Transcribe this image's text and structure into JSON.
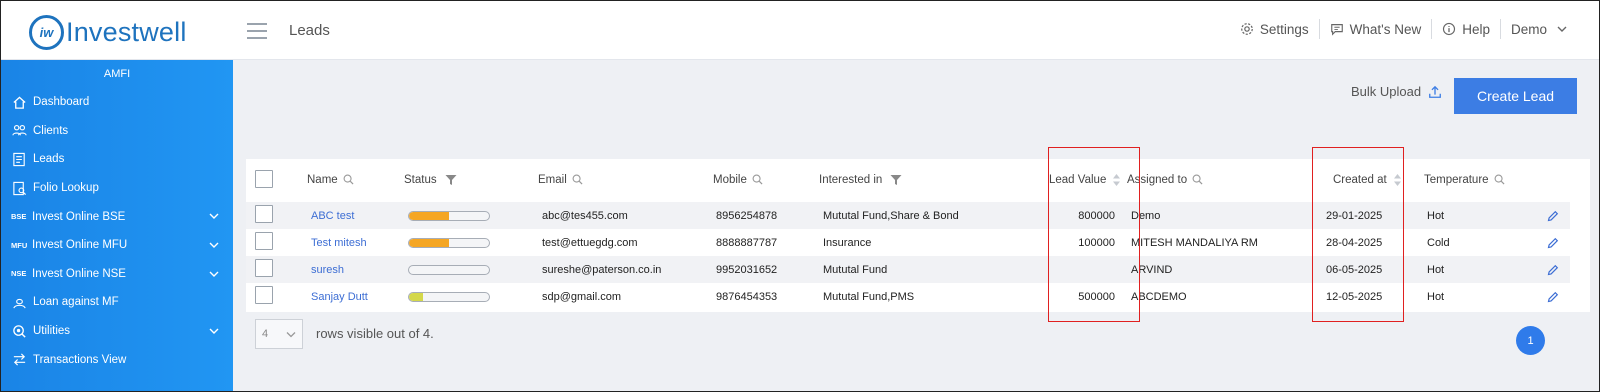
{
  "brand": {
    "logo_mark": "iw",
    "name": "Investwell"
  },
  "header": {
    "page_title": "Leads",
    "actions": [
      {
        "label": "Settings",
        "icon": "gear-icon"
      },
      {
        "label": "What's New",
        "icon": "message-icon"
      },
      {
        "label": "Help",
        "icon": "info-icon"
      },
      {
        "label": "Demo",
        "icon": "chevron-down-icon"
      }
    ]
  },
  "sidebar": {
    "org": "AMFI",
    "items": [
      {
        "label": "Dashboard",
        "icon": "home-icon"
      },
      {
        "label": "Clients",
        "icon": "users-icon"
      },
      {
        "label": "Leads",
        "icon": "leads-icon"
      },
      {
        "label": "Folio Lookup",
        "icon": "folio-icon"
      },
      {
        "label": "Invest Online BSE",
        "tag": "BSE",
        "expandable": true
      },
      {
        "label": "Invest Online MFU",
        "tag": "MFU",
        "expandable": true
      },
      {
        "label": "Invest Online NSE",
        "tag": "NSE",
        "expandable": true
      },
      {
        "label": "Loan against MF",
        "icon": "loan-icon"
      },
      {
        "label": "Utilities",
        "icon": "utilities-icon",
        "expandable": true
      },
      {
        "label": "Transactions View",
        "icon": "transfer-icon"
      }
    ]
  },
  "toolbar": {
    "bulk_upload": "Bulk Upload",
    "create_lead": "Create Lead"
  },
  "table": {
    "columns": {
      "name": "Name",
      "status": "Status",
      "email": "Email",
      "mobile": "Mobile",
      "interested": "Interested in",
      "lead_value": "Lead Value",
      "assigned": "Assigned to",
      "created": "Created at",
      "temperature": "Temperature"
    },
    "rows": [
      {
        "name": "ABC test",
        "status_progress": 0.5,
        "status_color": "#f5a623",
        "email": "abc@tes455.com",
        "mobile": "8956254878",
        "interested": "Mututal Fund,Share & Bond",
        "lead_value": "800000",
        "assigned": "Demo",
        "created": "29-01-2025",
        "temperature": "Hot"
      },
      {
        "name": "Test mitesh",
        "status_progress": 0.5,
        "status_color": "#f5a623",
        "email": "test@ettuegdg.com",
        "mobile": "8888887787",
        "interested": "Insurance",
        "lead_value": "100000",
        "assigned": "MITESH MANDALIYA RM",
        "created": "28-04-2025",
        "temperature": "Cold"
      },
      {
        "name": "suresh",
        "status_progress": 0,
        "status_color": "#f5a623",
        "email": "sureshe@paterson.co.in",
        "mobile": "9952031652",
        "interested": "Mututal Fund",
        "lead_value": "",
        "assigned": "ARVIND",
        "created": "06-05-2025",
        "temperature": "Hot"
      },
      {
        "name": "Sanjay Dutt",
        "status_progress": 0.17,
        "status_color": "#d4d84a",
        "email": "sdp@gmail.com",
        "mobile": "9876454353",
        "interested": "Mututal Fund,PMS",
        "lead_value": "500000",
        "assigned": "ABCDEMO",
        "created": "12-05-2025",
        "temperature": "Hot"
      }
    ]
  },
  "pagination": {
    "page_size": "4",
    "rows_text": "rows visible out of 4.",
    "current_page": "1"
  }
}
